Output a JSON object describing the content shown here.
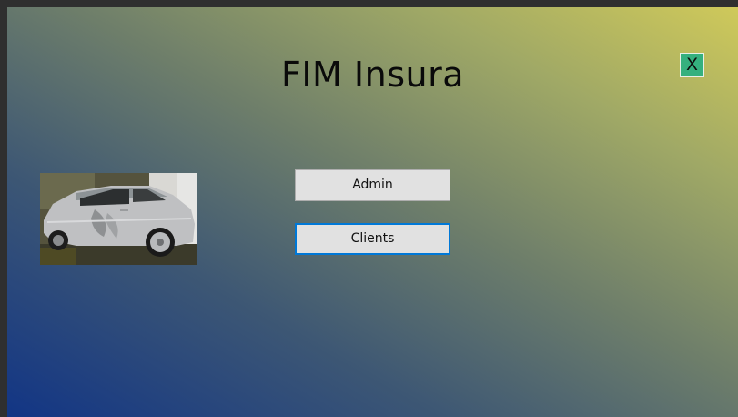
{
  "app": {
    "title": "FIM Insura"
  },
  "controls": {
    "close_label": "X",
    "admin_label": "Admin",
    "clients_label": "Clients"
  },
  "image": {
    "subject": "damaged silver car side view"
  },
  "colors": {
    "gradient_start": "#123585",
    "gradient_end": "#cfc95a",
    "close_button": "#35b07e",
    "button_face": "#e1e1e1",
    "focus_border": "#0078d7"
  }
}
